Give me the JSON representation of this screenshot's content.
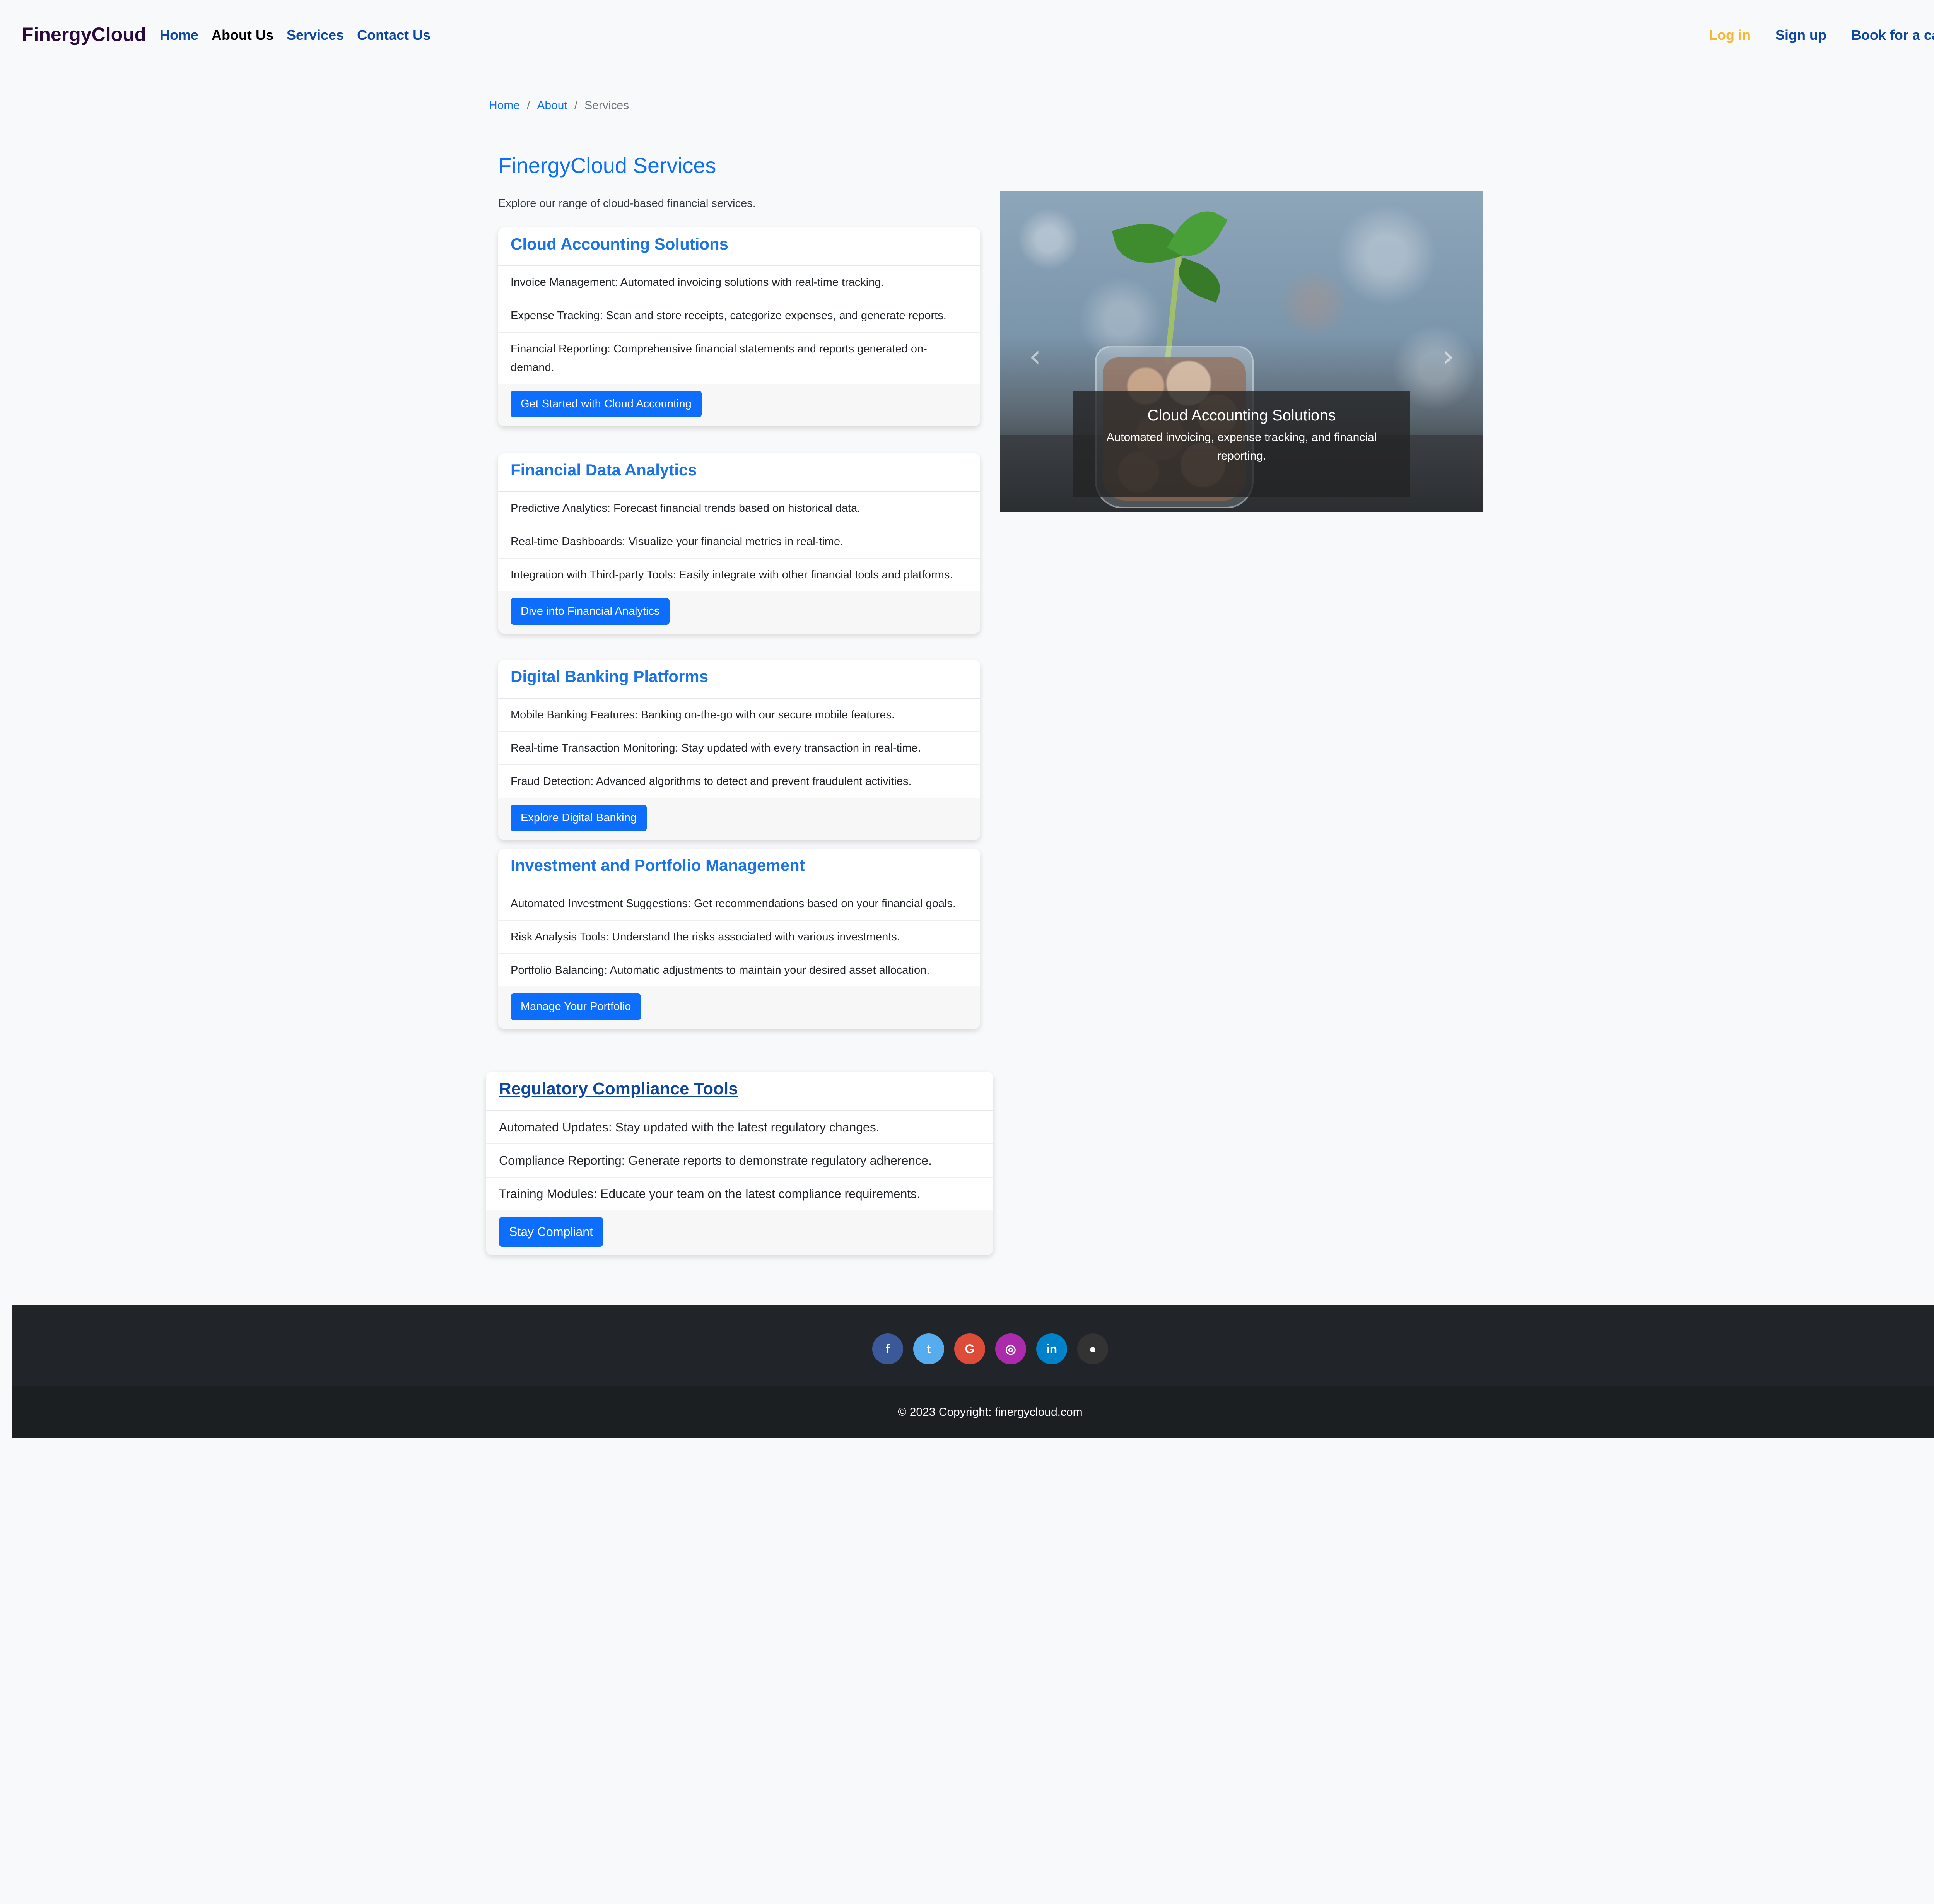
{
  "nav": {
    "brand": "FinergyCloud",
    "links": [
      "Home",
      "About Us",
      "Services",
      "Contact Us"
    ],
    "login": "Log in",
    "signup": "Sign up",
    "book": "Book for a call"
  },
  "breadcrumb": {
    "home": "Home",
    "about": "About",
    "current": "Services",
    "separator": "/"
  },
  "header": {
    "title": "FinergyCloud Services",
    "subtitle": "Explore our range of cloud-based financial services."
  },
  "cards": [
    {
      "title": "Cloud Accounting Solutions",
      "items": [
        "Invoice Management: Automated invoicing solutions with real-time tracking.",
        "Expense Tracking: Scan and store receipts, categorize expenses, and generate reports.",
        "Financial Reporting: Comprehensive financial statements and reports generated on-demand."
      ],
      "button": "Get Started with Cloud Accounting"
    },
    {
      "title": "Financial Data Analytics",
      "items": [
        "Predictive Analytics: Forecast financial trends based on historical data.",
        "Real-time Dashboards: Visualize your financial metrics in real-time.",
        "Integration with Third-party Tools: Easily integrate with other financial tools and platforms."
      ],
      "button": "Dive into Financial Analytics"
    },
    {
      "title": "Digital Banking Platforms",
      "items": [
        "Mobile Banking Features: Banking on-the-go with our secure mobile features.",
        "Real-time Transaction Monitoring: Stay updated with every transaction in real-time.",
        "Fraud Detection: Advanced algorithms to detect and prevent fraudulent activities."
      ],
      "button": "Explore Digital Banking"
    },
    {
      "title": "Investment and Portfolio Management",
      "items": [
        "Automated Investment Suggestions: Get recommendations based on your financial goals.",
        "Risk Analysis Tools: Understand the risks associated with various investments.",
        "Portfolio Balancing: Automatic adjustments to maintain your desired asset allocation."
      ],
      "button": "Manage Your Portfolio"
    },
    {
      "title": "Regulatory Compliance Tools",
      "items": [
        "Automated Updates: Stay updated with the latest regulatory changes.",
        "Compliance Reporting: Generate reports to demonstrate regulatory adherence.",
        "Training Modules: Educate your team on the latest compliance requirements."
      ],
      "button": "Stay Compliant"
    }
  ],
  "carousel": {
    "caption_title": "Cloud Accounting Solutions",
    "caption_text": "Automated invoicing, expense tracking, and financial reporting.",
    "prev_icon": "chevron-left-icon",
    "next_icon": "chevron-right-icon"
  },
  "footer": {
    "social": [
      {
        "icon": "facebook-icon",
        "glyph": "f",
        "color": "#3b5998"
      },
      {
        "icon": "twitter-icon",
        "glyph": "t",
        "color": "#55acee"
      },
      {
        "icon": "google-icon",
        "glyph": "G",
        "color": "#dd4b39"
      },
      {
        "icon": "instagram-icon",
        "glyph": "◎",
        "color": "#ac2bac"
      },
      {
        "icon": "linkedin-icon",
        "glyph": "in",
        "color": "#0082ca"
      },
      {
        "icon": "github-icon",
        "glyph": "●",
        "color": "#333333"
      }
    ],
    "copyright": "© 2023 Copyright: finergycloud.com"
  },
  "colors": {
    "primary": "#0d6efd",
    "login": "#f5b82e",
    "nav_link": "#0d47a1",
    "footer_bg": "#212529"
  }
}
